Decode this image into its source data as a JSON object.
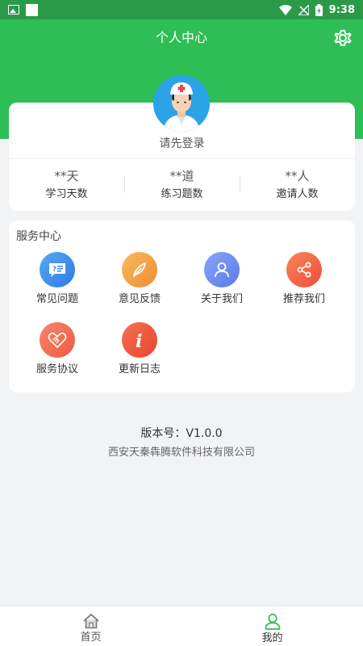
{
  "status_bar": {
    "time": "9:38"
  },
  "header": {
    "title": "个人中心",
    "settings_icon": "gear-icon"
  },
  "profile": {
    "login_prompt": "请先登录",
    "stats": [
      {
        "value": "**天",
        "label": "学习天数"
      },
      {
        "value": "**道",
        "label": "练习题数"
      },
      {
        "value": "**人",
        "label": "邀请人数"
      }
    ]
  },
  "service": {
    "title": "服务中心",
    "items": [
      {
        "label": "常见问题",
        "icon": "faq-icon",
        "color": "#3f8ef0"
      },
      {
        "label": "意见反馈",
        "icon": "feather-icon",
        "color": "#f5a145"
      },
      {
        "label": "关于我们",
        "icon": "person-icon",
        "color": "#6f8ff5"
      },
      {
        "label": "推荐我们",
        "icon": "share-icon",
        "color": "#f3603f"
      },
      {
        "label": "服务协议",
        "icon": "handshake-icon",
        "color": "#f26a4e"
      },
      {
        "label": "更新日志",
        "icon": "info-icon",
        "color": "#f0553a"
      }
    ]
  },
  "footer": {
    "version": "版本号：V1.0.0",
    "company": "西安天秦犇腾软件科技有限公司"
  },
  "tabbar": {
    "tabs": [
      {
        "label": "首页",
        "icon": "home-icon"
      },
      {
        "label": "我的",
        "icon": "user-icon"
      }
    ],
    "active_color": "#2fbe55"
  },
  "colors": {
    "brand": "#2fbe55",
    "status_bar": "#2a9a48"
  }
}
